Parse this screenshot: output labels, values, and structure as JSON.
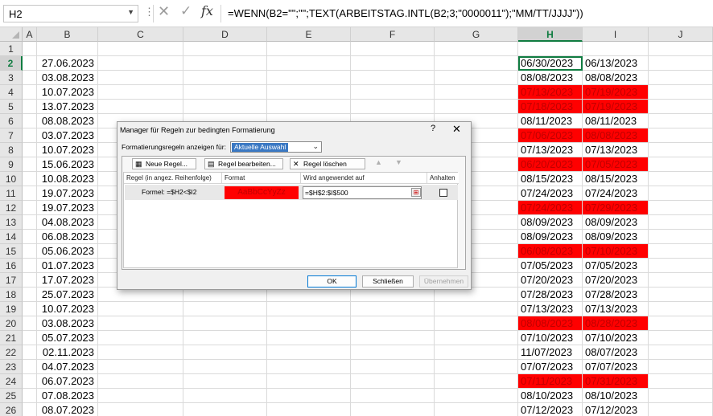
{
  "formula_bar": {
    "name_box": "H2",
    "formula": "=WENN(B2=\"\";\"\";TEXT(ARBEITSTAG.INTL(B2;3;\"0000011\");\"MM/TT/JJJJ\"))"
  },
  "columns": [
    "A",
    "B",
    "C",
    "D",
    "E",
    "F",
    "G",
    "H",
    "I",
    "J"
  ],
  "selected_column": "H",
  "rows": [
    {
      "n": "1",
      "b": "",
      "h": "",
      "i": "",
      "red": false
    },
    {
      "n": "2",
      "b": "27.06.2023",
      "h": "06/30/2023",
      "i": "06/13/2023",
      "red": false
    },
    {
      "n": "3",
      "b": "03.08.2023",
      "h": "08/08/2023",
      "i": "08/08/2023",
      "red": false
    },
    {
      "n": "4",
      "b": "10.07.2023",
      "h": "07/13/2023",
      "i": "07/19/2023",
      "red": true
    },
    {
      "n": "5",
      "b": "13.07.2023",
      "h": "07/18/2023",
      "i": "07/19/2023",
      "red": true
    },
    {
      "n": "6",
      "b": "08.08.2023",
      "h": "08/11/2023",
      "i": "08/11/2023",
      "red": false
    },
    {
      "n": "7",
      "b": "03.07.2023",
      "h": "07/06/2023",
      "i": "08/08/2023",
      "red": true
    },
    {
      "n": "8",
      "b": "10.07.2023",
      "h": "07/13/2023",
      "i": "07/13/2023",
      "red": false
    },
    {
      "n": "9",
      "b": "15.06.2023",
      "h": "06/20/2023",
      "i": "07/05/2023",
      "red": true
    },
    {
      "n": "10",
      "b": "10.08.2023",
      "h": "08/15/2023",
      "i": "08/15/2023",
      "red": false
    },
    {
      "n": "11",
      "b": "19.07.2023",
      "h": "07/24/2023",
      "i": "07/24/2023",
      "red": false
    },
    {
      "n": "12",
      "b": "19.07.2023",
      "h": "07/24/2023",
      "i": "07/29/2023",
      "red": true
    },
    {
      "n": "13",
      "b": "04.08.2023",
      "h": "08/09/2023",
      "i": "08/09/2023",
      "red": false
    },
    {
      "n": "14",
      "b": "06.08.2023",
      "h": "08/09/2023",
      "i": "08/09/2023",
      "red": false
    },
    {
      "n": "15",
      "b": "05.06.2023",
      "h": "06/08/2023",
      "i": "07/10/2023",
      "red": true
    },
    {
      "n": "16",
      "b": "01.07.2023",
      "h": "07/05/2023",
      "i": "07/05/2023",
      "red": false
    },
    {
      "n": "17",
      "b": "17.07.2023",
      "h": "07/20/2023",
      "i": "07/20/2023",
      "red": false
    },
    {
      "n": "18",
      "b": "25.07.2023",
      "h": "07/28/2023",
      "i": "07/28/2023",
      "red": false
    },
    {
      "n": "19",
      "b": "10.07.2023",
      "h": "07/13/2023",
      "i": "07/13/2023",
      "red": false
    },
    {
      "n": "20",
      "b": "03.08.2023",
      "h": "08/08/2023",
      "i": "08/28/2023",
      "red": true
    },
    {
      "n": "21",
      "b": "05.07.2023",
      "h": "07/10/2023",
      "i": "07/10/2023",
      "red": false
    },
    {
      "n": "22",
      "b": "02.11.2023",
      "h": "11/07/2023",
      "i": "08/07/2023",
      "red": false
    },
    {
      "n": "23",
      "b": "04.07.2023",
      "h": "07/07/2023",
      "i": "07/07/2023",
      "red": false
    },
    {
      "n": "24",
      "b": "06.07.2023",
      "h": "07/11/2023",
      "i": "07/31/2023",
      "red": true
    },
    {
      "n": "25",
      "b": "07.08.2023",
      "h": "08/10/2023",
      "i": "08/10/2023",
      "red": false
    },
    {
      "n": "26",
      "b": "08.07.2023",
      "h": "07/12/2023",
      "i": "07/12/2023",
      "red": false
    }
  ],
  "highlight_color": "#ff0000",
  "dialog": {
    "title": "Manager für Regeln zur bedingten Formatierung",
    "help": "?",
    "close": "✕",
    "show_rules_label": "Formatierungsregeln anzeigen für:",
    "show_rules_value": "Aktuelle Auswahl",
    "new_rule": "Neue Regel...",
    "edit_rule": "Regel bearbeiten...",
    "delete_rule": "Regel löschen",
    "col_rule": "Regel (in angez. Reihenfolge)",
    "col_format": "Format",
    "col_applies": "Wird angewendet auf",
    "col_stop": "Anhalten",
    "rule_text": "Formel: =$H2<$I2",
    "format_preview": "AaBbCcYyZz",
    "applies_to": "=$H$2:$I$500",
    "ok": "OK",
    "close_btn": "Schließen",
    "apply": "Übernehmen"
  }
}
